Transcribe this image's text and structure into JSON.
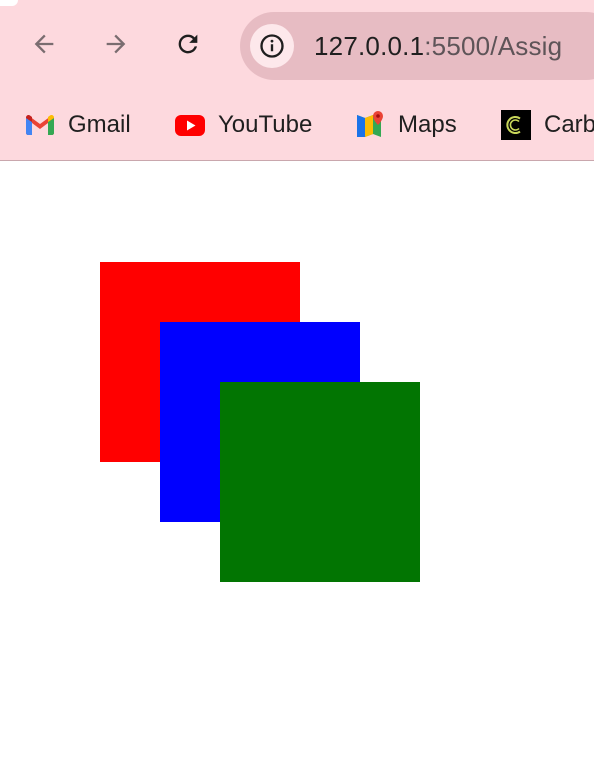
{
  "browser": {
    "address": {
      "host": "127.0.0.1",
      "rest": ":5500/Assig"
    },
    "bookmarks": [
      {
        "label": "Gmail",
        "icon": "gmail-icon"
      },
      {
        "label": "YouTube",
        "icon": "youtube-icon"
      },
      {
        "label": "Maps",
        "icon": "maps-icon"
      },
      {
        "label": "Carb",
        "icon": "carbon-icon"
      }
    ],
    "colors": {
      "toolbar": "#fdd9de",
      "omnibox": "#e7bcc3"
    }
  },
  "page": {
    "boxes": [
      {
        "color": "#ff0000"
      },
      {
        "color": "#0000ff"
      },
      {
        "color": "#027502"
      }
    ]
  }
}
